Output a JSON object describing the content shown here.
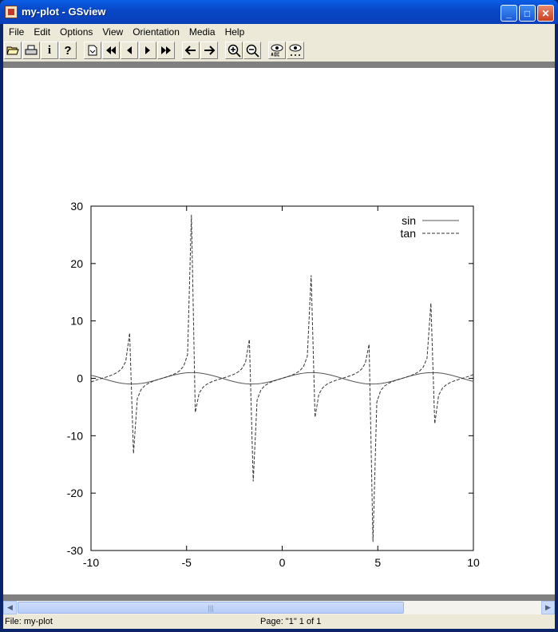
{
  "window": {
    "title": "my-plot - GSview"
  },
  "menu": [
    "File",
    "Edit",
    "Options",
    "View",
    "Orientation",
    "Media",
    "Help"
  ],
  "toolbar": {
    "info_label": "i",
    "help_label": "?",
    "buttons": [
      "open-icon",
      "print-icon",
      "info-icon",
      "help-icon",
      "goto-page-icon",
      "first-page-icon",
      "prev-page-icon",
      "next-page-icon",
      "last-page-icon",
      "back-icon",
      "forward-icon",
      "zoom-in-icon",
      "zoom-out-icon",
      "text-extract-icon",
      "find-icon"
    ]
  },
  "status": {
    "file": "File: my-plot",
    "page": "Page: \"1\"  1 of 1"
  },
  "chart_data": {
    "type": "line",
    "xlim": [
      -10,
      10
    ],
    "ylim": [
      -30,
      30
    ],
    "xticks": [
      "-10",
      "-5",
      "0",
      "5",
      "10"
    ],
    "yticks": [
      "30",
      "20",
      "10",
      "0",
      "-10",
      "-20",
      "-30"
    ],
    "xtick_values": [
      -10,
      -5,
      0,
      5,
      10
    ],
    "ytick_values": [
      30,
      20,
      10,
      0,
      -10,
      -20,
      -30
    ],
    "legend_position": "top-right",
    "series": [
      {
        "name": "sin",
        "function": "sin",
        "style": "solid",
        "color": "#555555"
      },
      {
        "name": "tan",
        "function": "tan",
        "style": "dashed",
        "color": "#333333"
      }
    ],
    "samples": 100
  }
}
